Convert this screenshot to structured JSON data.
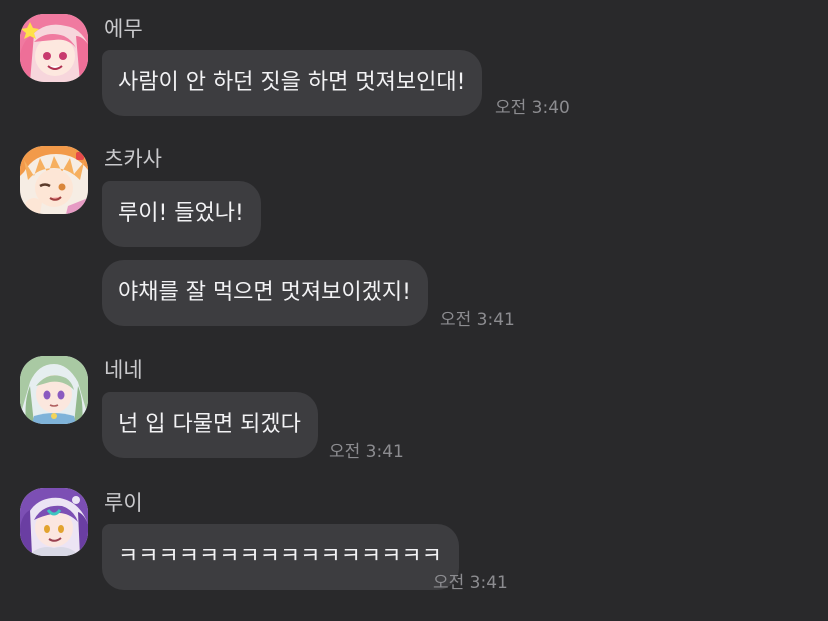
{
  "colors": {
    "background": "#29292b",
    "bubble": "#3d3d40",
    "bubble_text": "#f2f2f4",
    "sender_name": "#c9c9cc",
    "timestamp": "#8c8c90"
  },
  "messages": [
    {
      "sender": "에무",
      "avatar_icon": "emu-avatar-icon",
      "bubbles": [
        {
          "text": "사람이 안 하던 짓을 하면 멋져보인대!",
          "time": "오전 3:40"
        }
      ]
    },
    {
      "sender": "츠카사",
      "avatar_icon": "tsukasa-avatar-icon",
      "bubbles": [
        {
          "text": "루이! 들었나!",
          "time": ""
        },
        {
          "text": "야채를 잘 먹으면 멋져보이겠지!",
          "time": "오전 3:41"
        }
      ]
    },
    {
      "sender": "네네",
      "avatar_icon": "nene-avatar-icon",
      "bubbles": [
        {
          "text": "넌 입 다물면 되겠다",
          "time": "오전 3:41"
        }
      ]
    },
    {
      "sender": "루이",
      "avatar_icon": "rui-avatar-icon",
      "bubbles": [
        {
          "text": "ㅋㅋㅋㅋㅋㅋㅋㅋㅋㅋㅋㅋㅋㅋㅋㅋ",
          "time": "오전 3:41"
        }
      ]
    }
  ]
}
